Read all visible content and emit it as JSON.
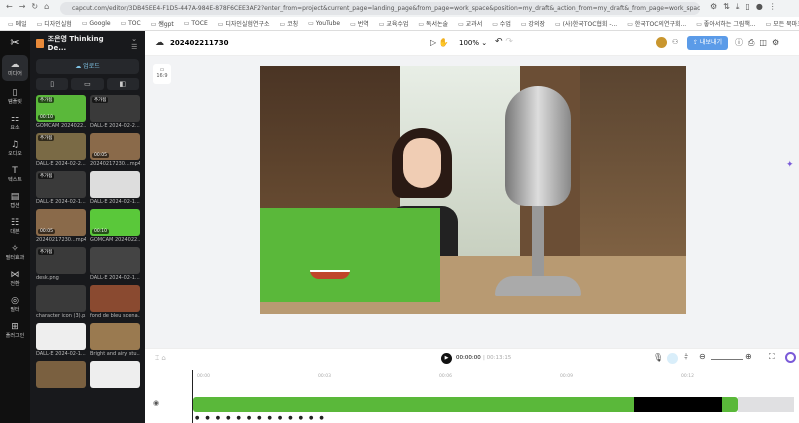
{
  "browser": {
    "url": "capcut.com/editor/3DB45EE4-F1D5-447A-984E-878F6CEE3AF2?enter_from=project&current_page=landing_page&from_page=work_space&position=my_draft&_action_from=my_draft&_from_page=work_space&scenari...",
    "bookmarks": [
      "메일",
      "디자인실험",
      "Google",
      "TOC",
      "쌤gpt",
      "TOCE",
      "디자인실험연구소",
      "코칭",
      "YouTube",
      "번역",
      "교육수업",
      "독서논술",
      "교과서",
      "수업",
      "강의장",
      "(사)한국TOC협회 -...",
      "한국TOC의연구회...",
      "좋아서하는 그림책...",
      "모든 북마크"
    ]
  },
  "panel": {
    "project": "조은영 Thinking De...",
    "upload": "업로드",
    "rail": [
      "미디어",
      "템플릿",
      "요소",
      "오디오",
      "텍스트",
      "캡션",
      "대본",
      "필터효과",
      "전환",
      "필터",
      "플러그인"
    ],
    "media": [
      {
        "name": "GOMCAM 2024022...",
        "badge": "추가됨",
        "dur": "00:10",
        "color": "#5ab83a"
      },
      {
        "name": "DALL·E 2024-02-2...",
        "badge": "추가됨",
        "dur": "",
        "color": "#3a3a3a"
      },
      {
        "name": "DALL·E 2024-02-2...",
        "badge": "추가됨",
        "dur": "",
        "color": "#7a6a45"
      },
      {
        "name": "20240217230...mp4",
        "badge": "",
        "dur": "00:05",
        "color": "#8a6a4a"
      },
      {
        "name": "DALL·E 2024-02-1...",
        "badge": "추가됨",
        "dur": "",
        "color": "#3a3a3a"
      },
      {
        "name": "DALL·E 2024-02-1...",
        "badge": "",
        "dur": "",
        "color": "#ddd"
      },
      {
        "name": "20240217230...mp4",
        "badge": "",
        "dur": "00:05",
        "color": "#8a6a4a"
      },
      {
        "name": "GOMCAM 2024022...",
        "badge": "",
        "dur": "00:10",
        "color": "#5ac83a"
      },
      {
        "name": "desk.png",
        "badge": "추가됨",
        "dur": "",
        "color": "#3a3a3a"
      },
      {
        "name": "DALL·E 2024-02-1...",
        "badge": "",
        "dur": "",
        "color": "#444"
      },
      {
        "name": "character icon (3).p...",
        "badge": "",
        "dur": "",
        "color": "#3a3a3a"
      },
      {
        "name": "fond de bleu scena...",
        "badge": "",
        "dur": "",
        "color": "#8a4a30"
      },
      {
        "name": "DALL·E 2024-02-1...",
        "badge": "",
        "dur": "",
        "color": "#eee"
      },
      {
        "name": "Bright and airy stu...",
        "badge": "",
        "dur": "",
        "color": "#9a7a50"
      },
      {
        "name": "",
        "badge": "",
        "dur": "",
        "color": "#7a6040"
      },
      {
        "name": "",
        "badge": "",
        "dur": "",
        "color": "#eee"
      }
    ]
  },
  "header": {
    "title": "202402211730",
    "zoom": "100%",
    "export": "내보내기"
  },
  "canvas": {
    "ratio": "16:9"
  },
  "player": {
    "current": "00:00:00",
    "total": "00:13:15"
  },
  "timeline": {
    "ticks": [
      "00:00",
      "00:03",
      "00:06",
      "00:09",
      "00:12"
    ]
  },
  "colors": {
    "accent": "#4a90e2",
    "green": "#5ab83a"
  }
}
